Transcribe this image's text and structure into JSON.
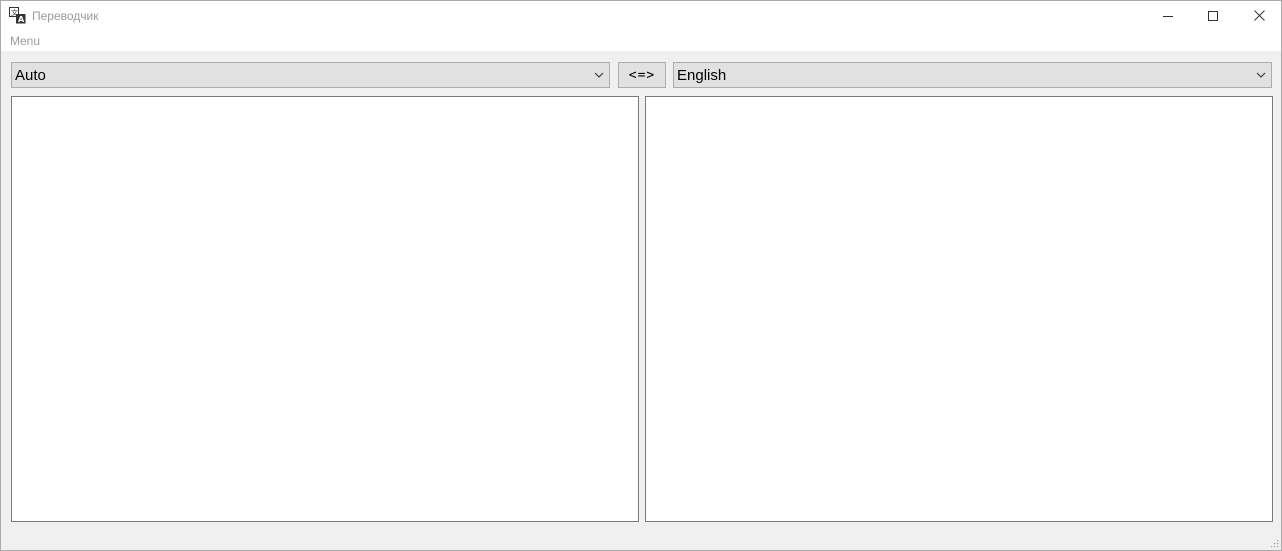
{
  "window": {
    "title": "Переводчик",
    "icon": "translate-icon"
  },
  "menu": {
    "items": [
      "Menu"
    ]
  },
  "toolbar": {
    "source_language": "Auto",
    "swap_label": "<=>",
    "target_language": "English"
  },
  "editors": {
    "source_text": "",
    "translated_text": ""
  },
  "colors": {
    "titlebar_bg": "#ffffff",
    "window_bg": "#f0f0f0",
    "combo_bg": "#e1e1e1",
    "muted_text": "#9a9a9a"
  }
}
